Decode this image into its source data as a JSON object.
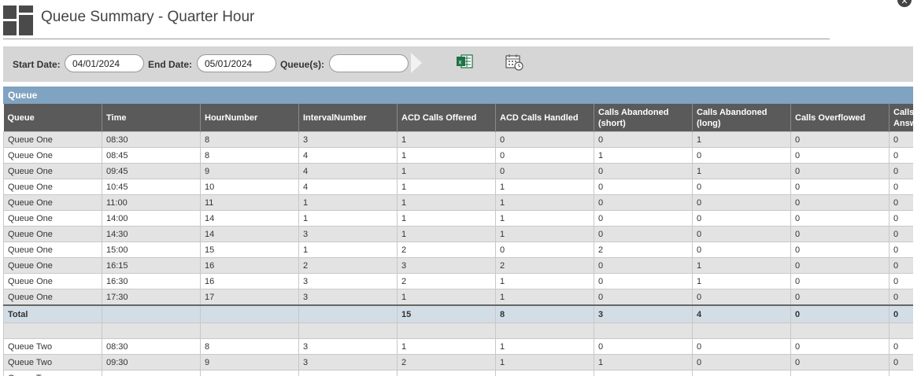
{
  "page": {
    "title": "Queue Summary - Quarter Hour",
    "close_glyph": "✕"
  },
  "toolbar": {
    "start_date_label": "Start Date:",
    "start_date_value": "04/01/2024",
    "end_date_label": "End Date:",
    "end_date_value": "05/01/2024",
    "queues_label": "Queue(s):",
    "queues_value": "",
    "export_icon": "excel-icon",
    "schedule_icon": "calendar-clock-icon"
  },
  "grid": {
    "group_header": "Queue",
    "columns": [
      "Queue",
      "Time",
      "HourNumber",
      "IntervalNumber",
      "ACD Calls Offered",
      "ACD Calls Handled",
      "Calls Abandoned (short)",
      "Calls Abandoned (long)",
      "Calls Overflowed",
      "Calls Answ"
    ],
    "rows": [
      [
        "Queue One",
        "08:30",
        "8",
        "3",
        "1",
        "0",
        "0",
        "1",
        "0",
        "0"
      ],
      [
        "Queue One",
        "08:45",
        "8",
        "4",
        "1",
        "0",
        "1",
        "0",
        "0",
        "0"
      ],
      [
        "Queue One",
        "09:45",
        "9",
        "4",
        "1",
        "0",
        "0",
        "1",
        "0",
        "0"
      ],
      [
        "Queue One",
        "10:45",
        "10",
        "4",
        "1",
        "1",
        "0",
        "0",
        "0",
        "0"
      ],
      [
        "Queue One",
        "11:00",
        "11",
        "1",
        "1",
        "1",
        "0",
        "0",
        "0",
        "0"
      ],
      [
        "Queue One",
        "14:00",
        "14",
        "1",
        "1",
        "1",
        "0",
        "0",
        "0",
        "0"
      ],
      [
        "Queue One",
        "14:30",
        "14",
        "3",
        "1",
        "1",
        "0",
        "0",
        "0",
        "0"
      ],
      [
        "Queue One",
        "15:00",
        "15",
        "1",
        "2",
        "0",
        "2",
        "0",
        "0",
        "0"
      ],
      [
        "Queue One",
        "16:15",
        "16",
        "2",
        "3",
        "2",
        "0",
        "1",
        "0",
        "0"
      ],
      [
        "Queue One",
        "16:30",
        "16",
        "3",
        "2",
        "1",
        "0",
        "1",
        "0",
        "0"
      ],
      [
        "Queue One",
        "17:30",
        "17",
        "3",
        "1",
        "1",
        "0",
        "0",
        "0",
        "0"
      ]
    ],
    "total": [
      "Total",
      "",
      "",
      "",
      "15",
      "8",
      "3",
      "4",
      "0",
      "0"
    ],
    "rows2": [
      [
        "Queue Two",
        "08:30",
        "8",
        "3",
        "1",
        "1",
        "0",
        "0",
        "0",
        "0"
      ],
      [
        "Queue Two",
        "09:30",
        "9",
        "3",
        "2",
        "1",
        "1",
        "0",
        "0",
        "0"
      ],
      [
        "Queue Two",
        "",
        "",
        "",
        "",
        "",
        "",
        "",
        "",
        ""
      ]
    ]
  }
}
